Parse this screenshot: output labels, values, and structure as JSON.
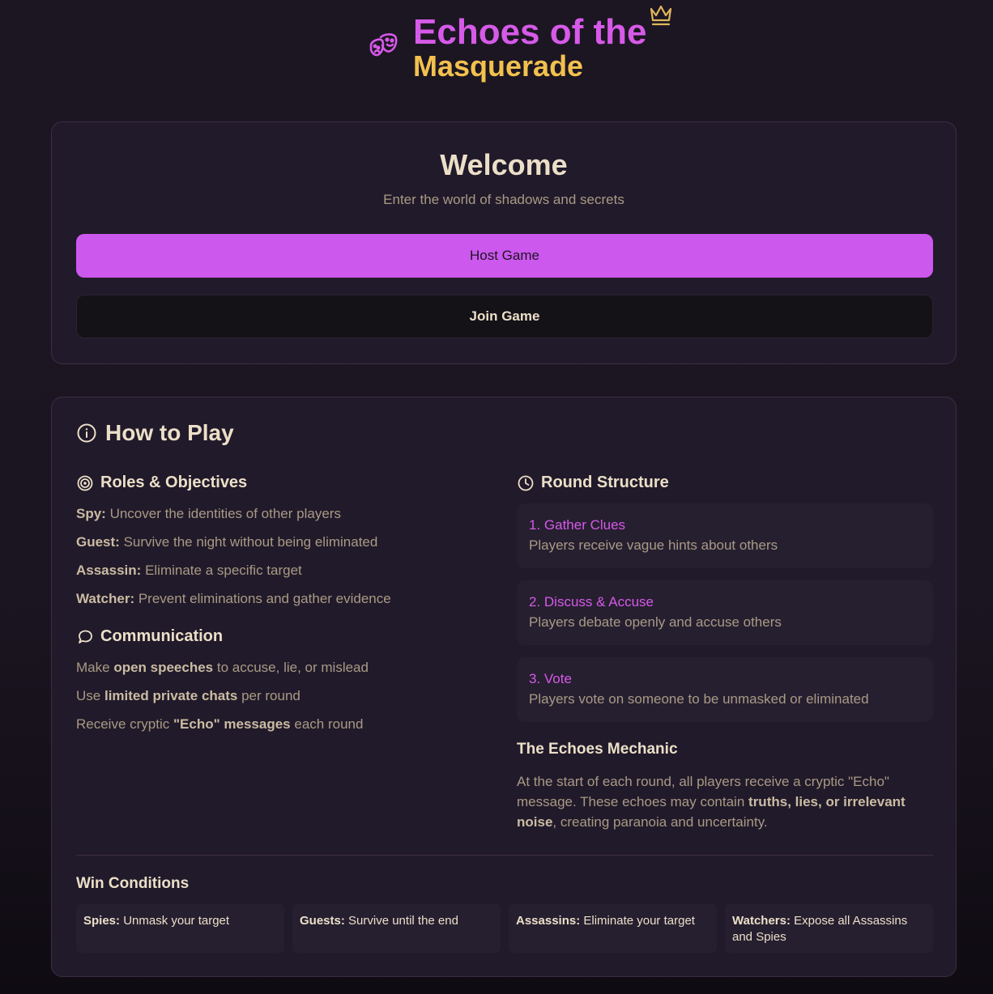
{
  "header": {
    "title_line1": "Echoes of the",
    "title_line2": "Masquerade",
    "left_icon": "theater-mask-icon",
    "crown_icon": "crown-icon",
    "colors": {
      "title_primary": "#d65ae8",
      "title_secondary": "#f2c14e"
    }
  },
  "welcome": {
    "title": "Welcome",
    "subtitle": "Enter the world of shadows and secrets",
    "host_label": "Host Game",
    "join_label": "Join Game",
    "colors": {
      "host_button": "#cc58ee"
    }
  },
  "how_to_play": {
    "title": "How to Play",
    "roles": {
      "heading": "Roles & Objectives",
      "items": [
        {
          "role": "Spy:",
          "text": "Uncover the identities of other players"
        },
        {
          "role": "Guest:",
          "text": "Survive the night without being eliminated"
        },
        {
          "role": "Assassin:",
          "text": "Eliminate a specific target"
        },
        {
          "role": "Watcher:",
          "text": "Prevent eliminations and gather evidence"
        }
      ]
    },
    "communication": {
      "heading": "Communication",
      "items": [
        {
          "pre": "Make",
          "bold": "open speeches",
          "post": "to accuse, lie, or mislead"
        },
        {
          "pre": "Use",
          "bold": "limited private chats",
          "post": "per round"
        },
        {
          "pre": "Receive cryptic",
          "bold": "\"Echo\" messages",
          "post": "each round"
        }
      ]
    },
    "round_structure": {
      "heading": "Round Structure",
      "steps": [
        {
          "title": "1. Gather Clues",
          "desc": "Players receive vague hints about others"
        },
        {
          "title": "2. Discuss & Accuse",
          "desc": "Players debate openly and accuse others"
        },
        {
          "title": "3. Vote",
          "desc": "Players vote on someone to be unmasked or eliminated"
        }
      ]
    },
    "echoes": {
      "heading": "The Echoes Mechanic",
      "text_pre": "At the start of each round, all players receive a cryptic \"Echo\" message. These echoes may contain",
      "text_bold": "truths, lies, or irrelevant noise",
      "text_post": ", creating paranoia and uncertainty."
    },
    "win_conditions": {
      "heading": "Win Conditions",
      "items": [
        {
          "role": "Spies:",
          "text": "Unmask your target"
        },
        {
          "role": "Guests:",
          "text": "Survive until the end"
        },
        {
          "role": "Assassins:",
          "text": "Eliminate your target"
        },
        {
          "role": "Watchers:",
          "text": "Expose all Assassins and Spies"
        }
      ]
    }
  }
}
